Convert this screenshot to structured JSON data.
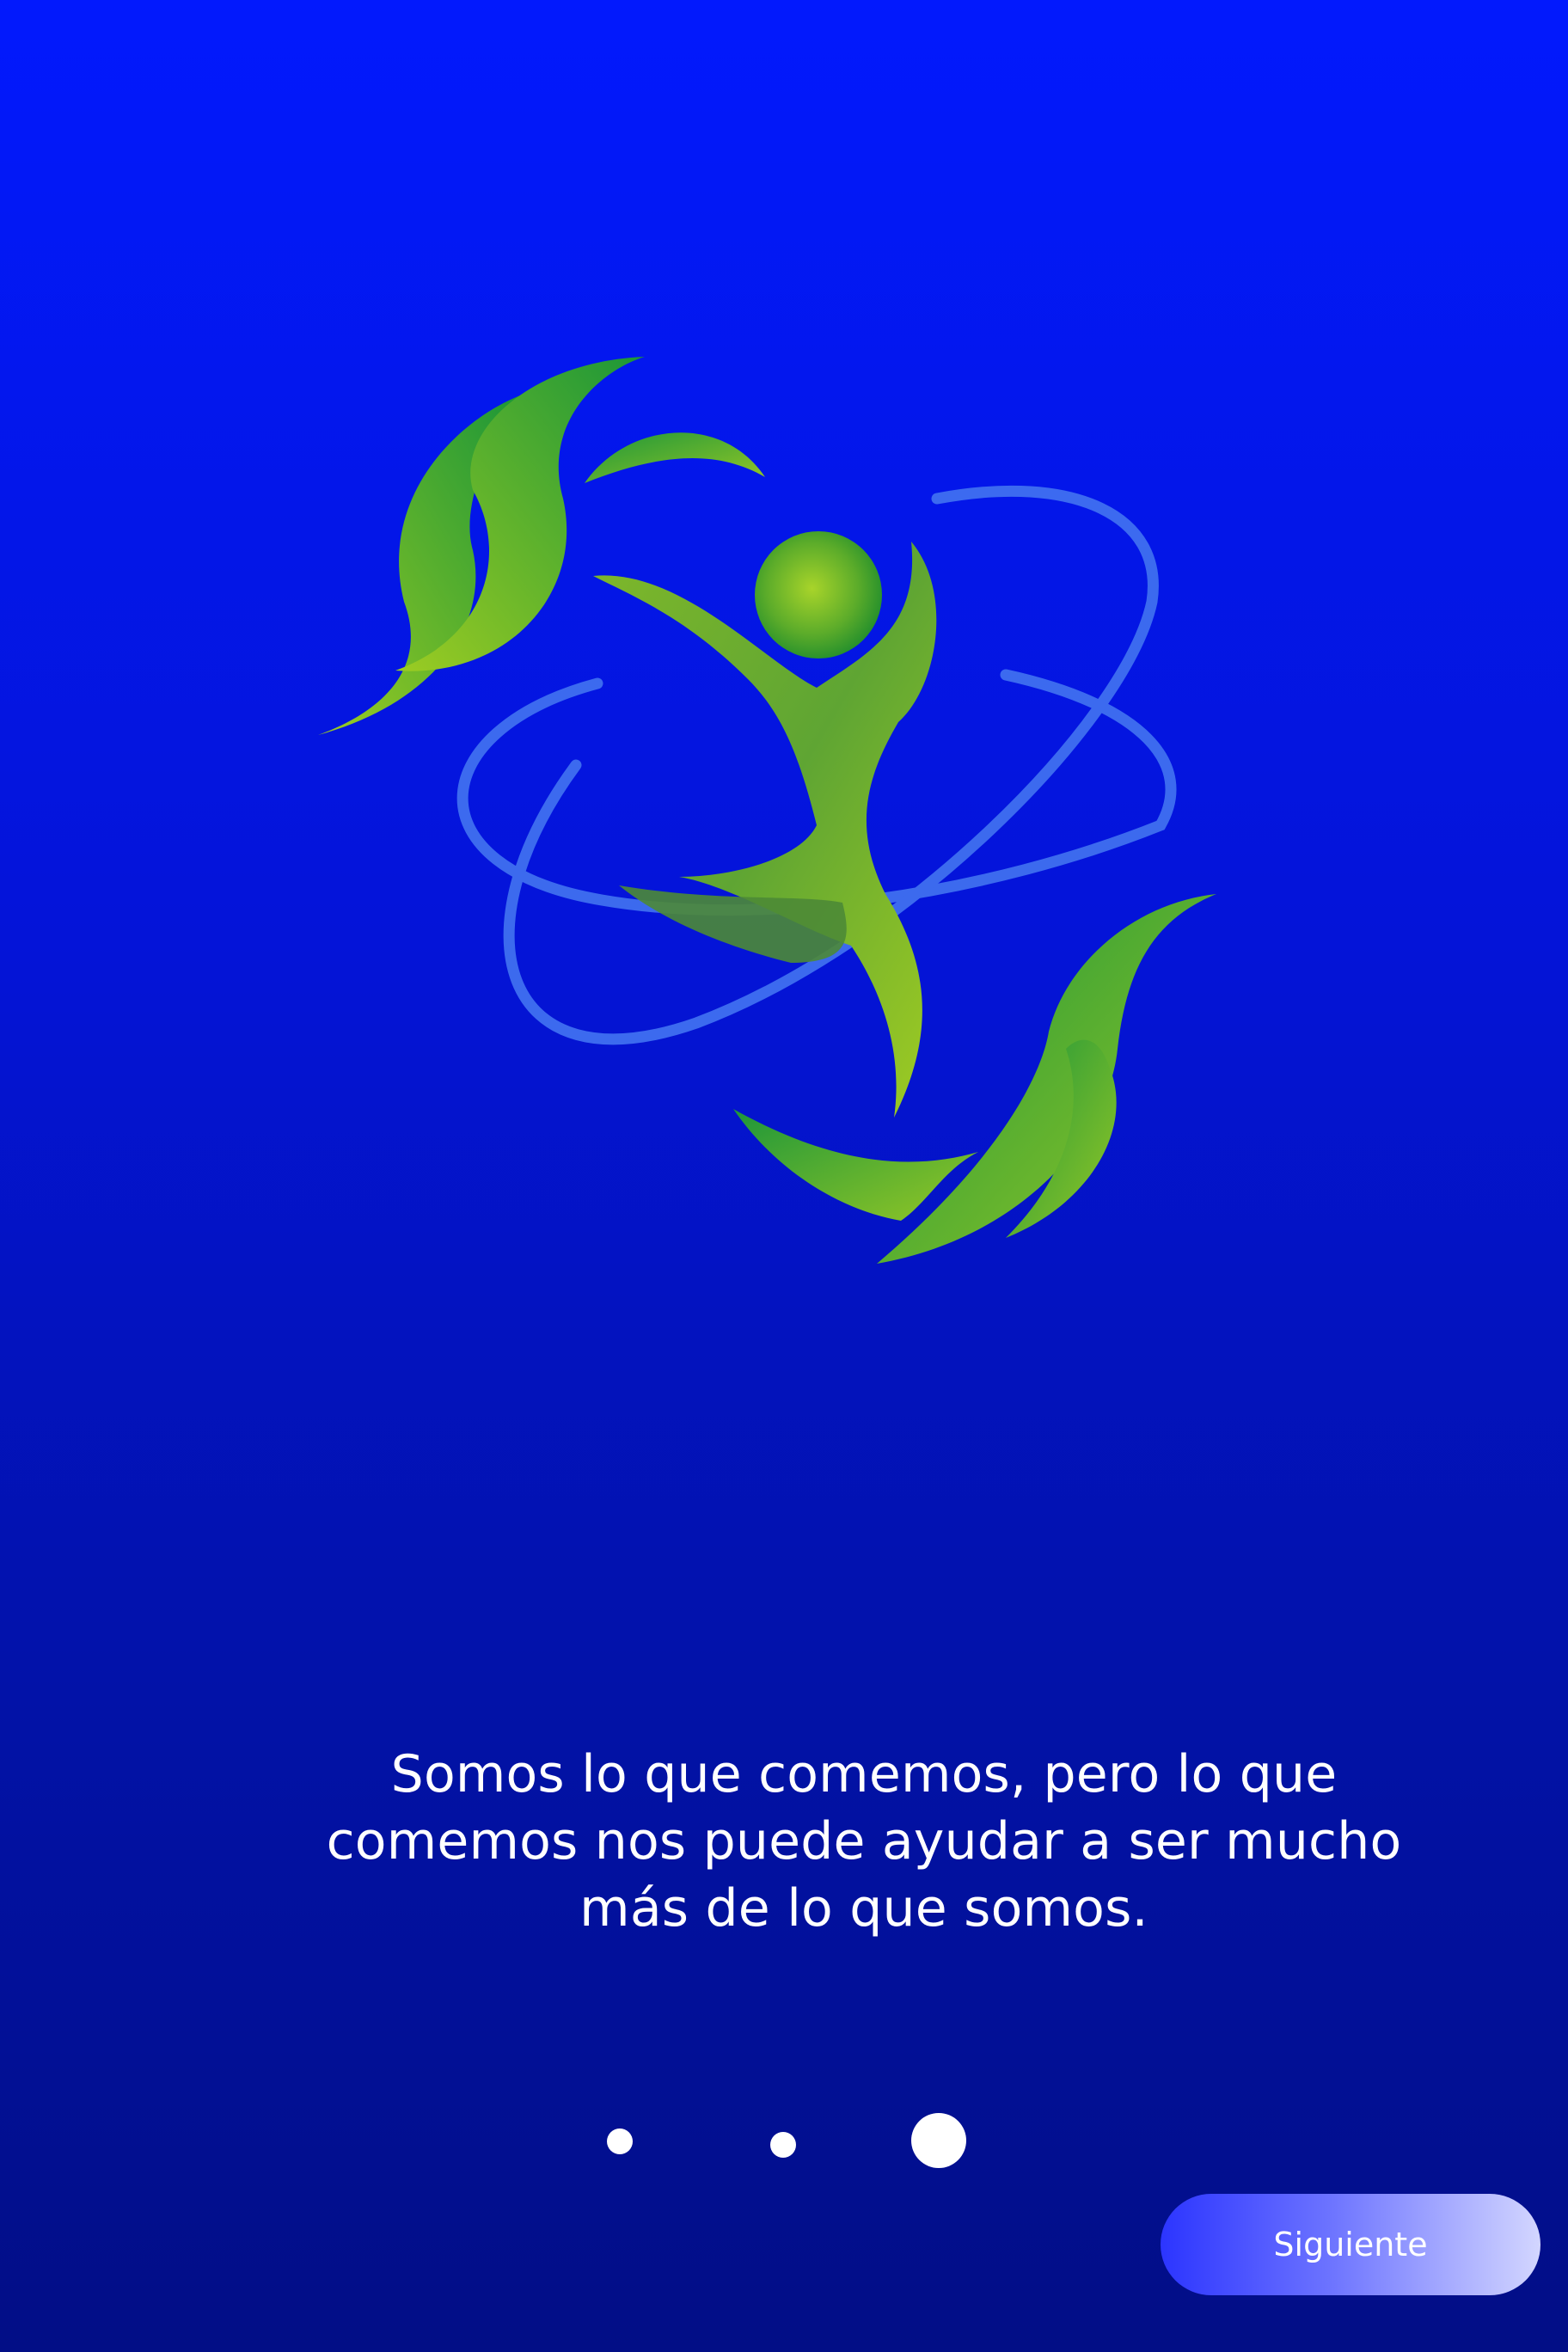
{
  "onboarding": {
    "logo_icon": "green-figure-with-leaves-and-orbits-logo",
    "tagline": "Somos lo que comemos, pero lo que comemos nos puede ayudar a ser mucho más de lo que somos.",
    "pager": {
      "total": 3,
      "current": 3
    },
    "next_label": "Siguiente"
  },
  "colors": {
    "background_top": "#0219fd",
    "background_bottom": "#020e86",
    "leaf_green_dark": "#1e9a3a",
    "leaf_green_light": "#8dc325",
    "orbit_blue": "#3f6ff0",
    "button_start": "#2c35ff",
    "button_end": "#d3d6ff",
    "text": "#ffffff"
  }
}
